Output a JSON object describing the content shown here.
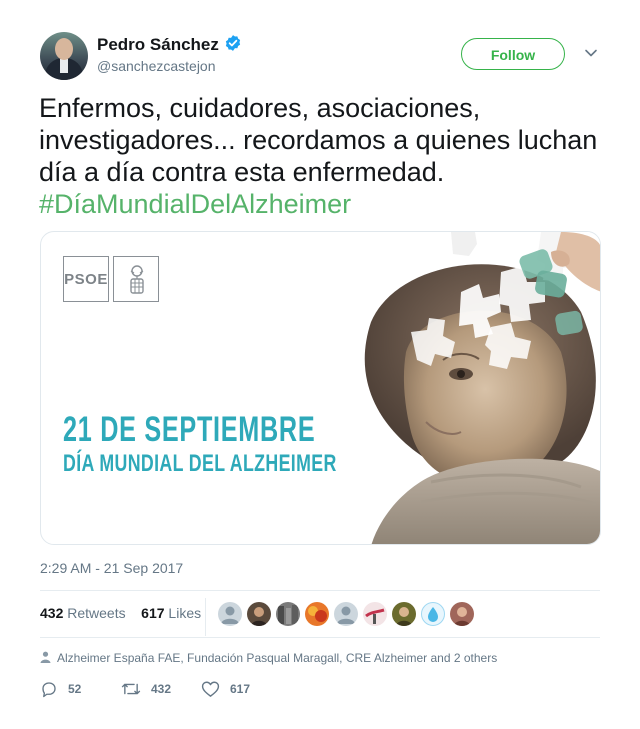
{
  "author": {
    "name": "Pedro Sánchez",
    "handle": "@sanchezcastejon",
    "verified": true
  },
  "follow_label": "Follow",
  "tweet": {
    "text": "Enfermos, cuidadores, asociaciones, investigadores... recordamos a quienes luchan día a día contra esta enfermedad.",
    "hashtag": "#DíaMundialDelAlzheimer"
  },
  "media": {
    "logo_text": "PSOE",
    "line1": "21 DE SEPTIEMBRE",
    "line2": "DÍA MUNDIAL DEL ALZHEIMER"
  },
  "timestamp": "2:29 AM - 21 Sep 2017",
  "stats": {
    "retweets_count": "432",
    "retweets_label": "Retweets",
    "likes_count": "617",
    "likes_label": "Likes"
  },
  "context": "Alzheimer España FAE, Fundación Pasqual Maragall, CRE Alzheimer and 2 others",
  "actions": {
    "replies": "52",
    "retweets": "432",
    "likes": "617"
  },
  "colors": {
    "accent_green": "#36b34a",
    "hashtag_green": "#56b36a",
    "muted": "#657786",
    "teal_text": "#2ea9b9"
  }
}
